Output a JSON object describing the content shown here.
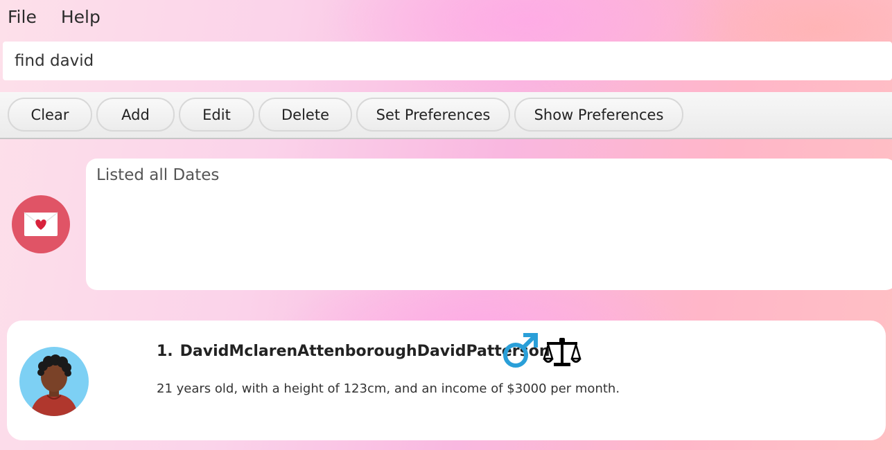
{
  "menu": {
    "file_label": "File",
    "help_label": "Help"
  },
  "command": {
    "value": "find david"
  },
  "toolbar": {
    "clear": "Clear",
    "add": "Add",
    "edit": "Edit",
    "delete": "Delete",
    "set_preferences": "Set Preferences",
    "show_preferences": "Show Preferences"
  },
  "result": {
    "message": "Listed all Dates"
  },
  "people": [
    {
      "index": "1.",
      "name": "DavidMclarenAttenboroughDavidPatterson",
      "description": "21 years old, with a height of 123cm, and an income of $3000 per month.",
      "gender_icon": "male-symbol-icon",
      "horoscope_icon": "libra-icon"
    }
  ],
  "colors": {
    "accent": "#e05466",
    "male": "#2a9fd8"
  }
}
